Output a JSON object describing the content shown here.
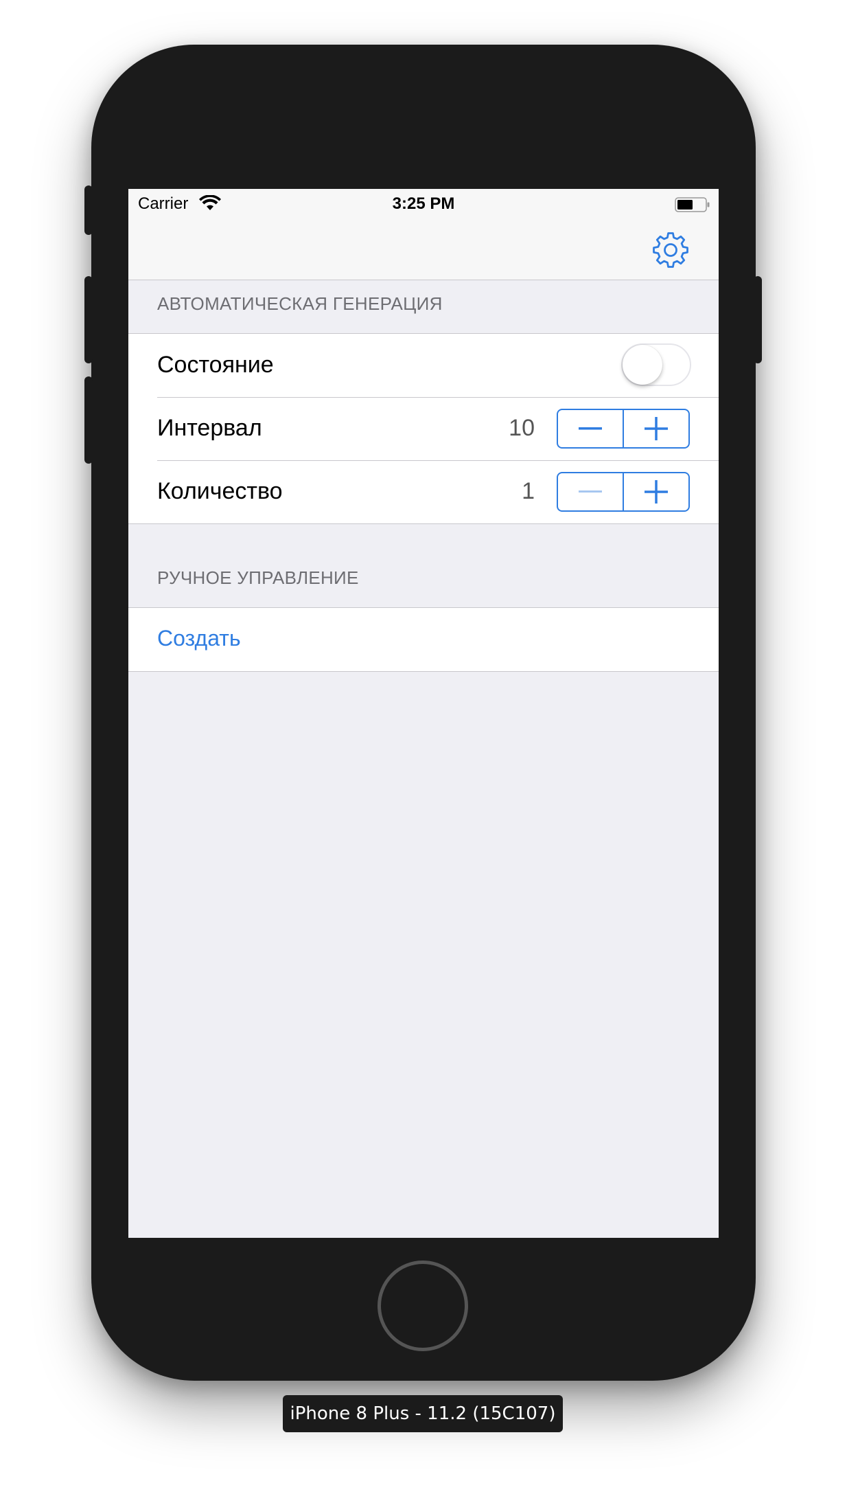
{
  "status_bar": {
    "carrier": "Carrier",
    "time": "3:25 PM",
    "wifi_icon": "wifi-icon",
    "battery_icon": "battery-icon"
  },
  "nav_bar": {
    "settings_icon": "gear-icon"
  },
  "auto_generation": {
    "header": "АВТОМАТИЧЕСКАЯ ГЕНЕРАЦИЯ",
    "state_label": "Состояние",
    "state_on": false,
    "interval_label": "Интервал",
    "interval_value": "10",
    "count_label": "Количество",
    "count_value": "1"
  },
  "manual_control": {
    "header": "РУЧНОЕ УПРАВЛЕНИЕ",
    "create_label": "Создать"
  },
  "device": {
    "label": "iPhone 8 Plus - 11.2 (15C107)"
  },
  "colors": {
    "accent": "#2f7de1",
    "background": "#efeff4",
    "device_body": "#1b1b1b"
  }
}
